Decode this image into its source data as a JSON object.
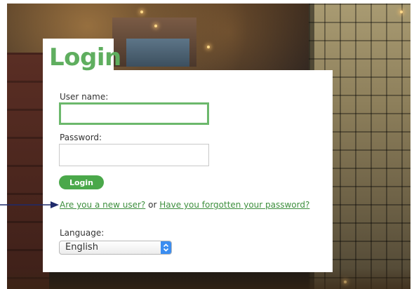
{
  "login": {
    "title": "Login",
    "username_label": "User name:",
    "username_value": "",
    "password_label": "Password:",
    "password_value": "",
    "login_button": "Login",
    "new_user_link": "Are you a new user?",
    "or_text": "or",
    "forgot_link": "Have you forgotten your password?",
    "language_label": "Language:",
    "language_value": "English"
  },
  "colors": {
    "accent_green": "#5fae5f",
    "button_green": "#4aa84a",
    "link_green": "#3e8f3e",
    "select_blue": "#3b8df0",
    "callout_arrow": "#1f2a6b"
  },
  "icons": {
    "callout": "arrow-right-icon",
    "select": "updown-chevron-icon"
  }
}
